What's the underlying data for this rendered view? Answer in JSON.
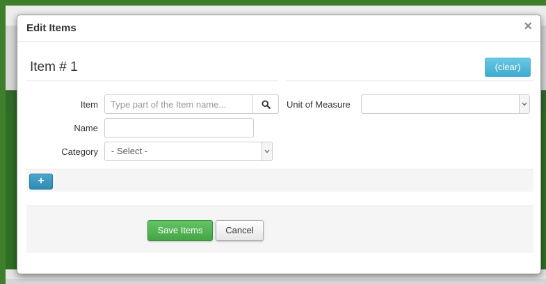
{
  "modal": {
    "title": "Edit Items",
    "close_glyph": "×"
  },
  "item": {
    "title": "Item # 1",
    "clear_label": "(clear)",
    "fields": {
      "item_label": "Item",
      "item_placeholder": "Type part of the Item name...",
      "item_value": "",
      "name_label": "Name",
      "name_value": "",
      "category_label": "Category",
      "category_selected": "- Select -",
      "uom_label": "Unit of Measure",
      "uom_selected": ""
    }
  },
  "add_item": {
    "label": "+"
  },
  "footer": {
    "save_label": "Save Items",
    "cancel_label": "Cancel"
  },
  "icons": {
    "search": "search-icon",
    "close": "close-icon",
    "dropdown": "chevron-down-icon"
  },
  "colors": {
    "accent_info": "#5bc0de",
    "primary_blue": "#3a96c1",
    "success_green": "#5cb85c",
    "background_green": "#3f7f2b"
  }
}
